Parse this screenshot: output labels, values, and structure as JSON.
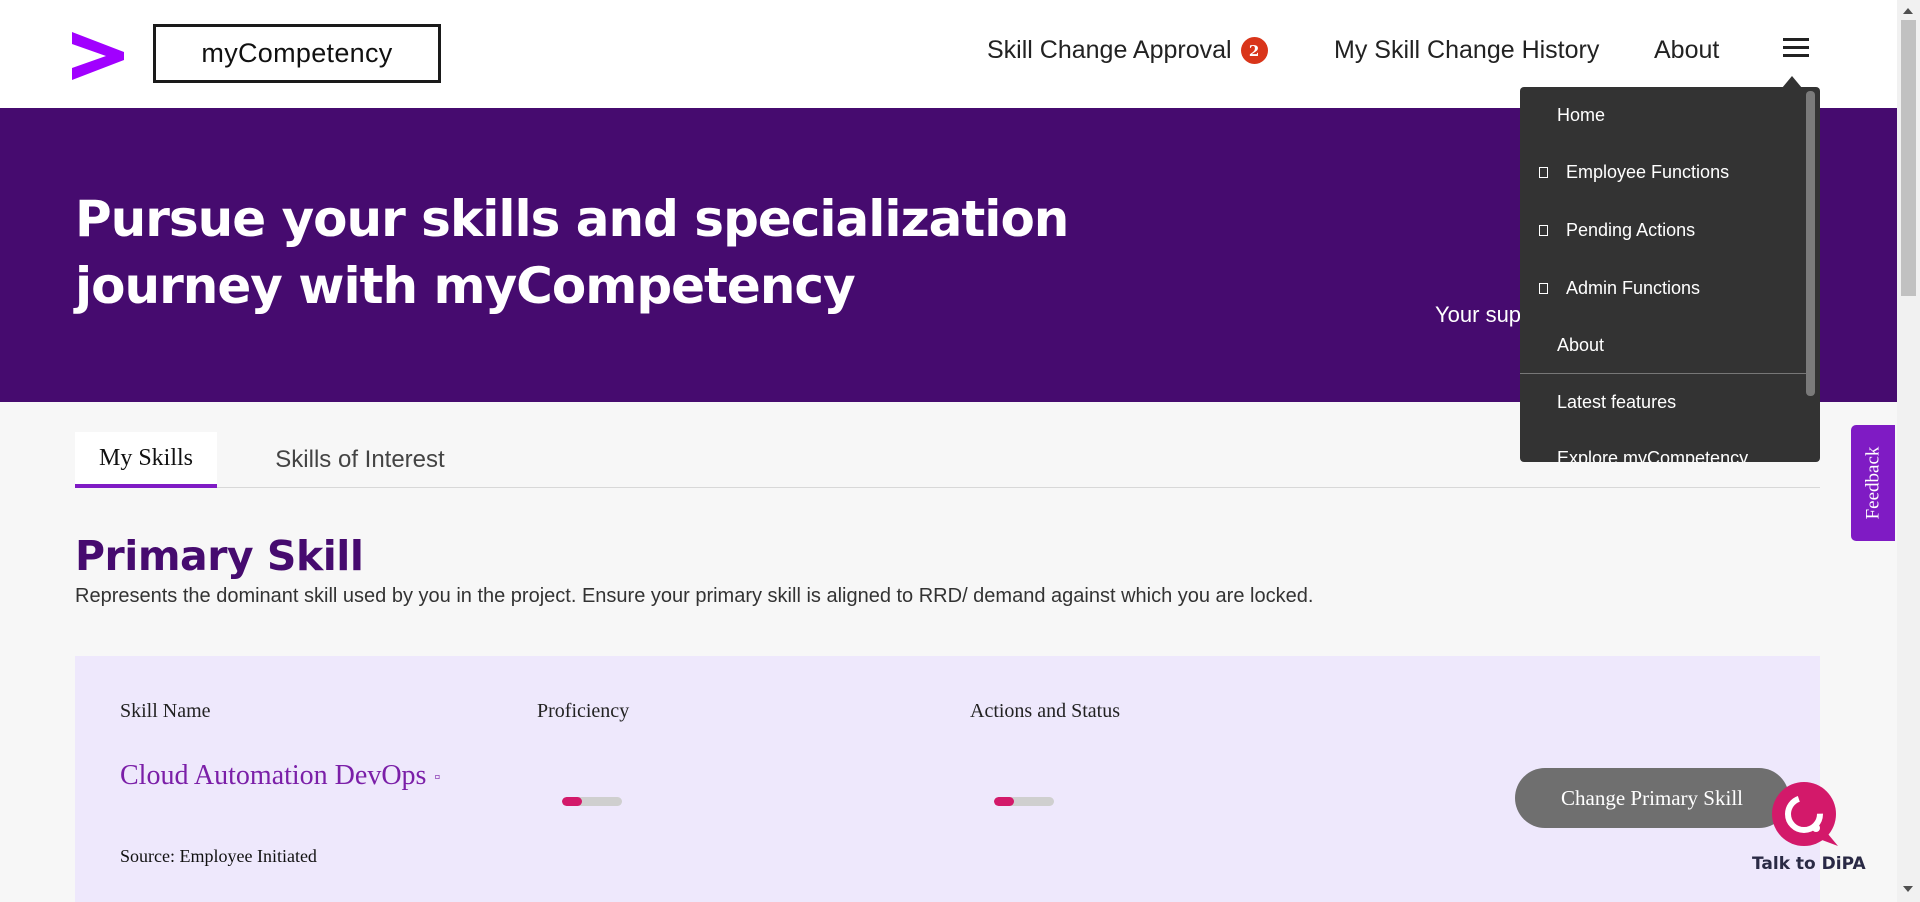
{
  "header": {
    "app_name": "myCompetency",
    "nav": {
      "approval_label": "Skill Change Approval",
      "approval_badge": "2",
      "history_label": "My Skill Change History",
      "about_label": "About"
    }
  },
  "hero": {
    "title": "Pursue your skills and specialization journey with myCompetency",
    "support_text_partial": "Your sup"
  },
  "tabs": [
    {
      "label": "My Skills",
      "active": true
    },
    {
      "label": "Skills of Interest",
      "active": false
    }
  ],
  "primary_skill": {
    "title": "Primary Skill",
    "description": "Represents the dominant skill used by you in the project. Ensure your primary skill is aligned to RRD/ demand against which you are locked.",
    "columns": {
      "name": "Skill Name",
      "proficiency": "Proficiency",
      "actions": "Actions and Status"
    },
    "skill_name": "Cloud Automation DevOps",
    "proficiency_level": 0.33,
    "status_level": 0.33,
    "source": "Source: Employee Initiated",
    "change_button": "Change Primary Skill"
  },
  "menu": {
    "items": [
      {
        "label": "Home",
        "expandable": false
      },
      {
        "label": "Employee Functions",
        "expandable": true
      },
      {
        "label": "Pending Actions",
        "expandable": true
      },
      {
        "label": "Admin Functions",
        "expandable": true
      },
      {
        "label": "About",
        "expandable": false
      },
      {
        "label": "Latest features",
        "expandable": false
      },
      {
        "label": "Explore myCompetency",
        "expandable": false
      }
    ]
  },
  "feedback_label": "Feedback",
  "dipa_label": "Talk to DiPA",
  "colors": {
    "brand_purple": "#460b6f",
    "accent_purple": "#7f1bc4",
    "badge_red": "#d9351a",
    "bar_fill": "#d3196a",
    "menu_bg": "#333333"
  }
}
